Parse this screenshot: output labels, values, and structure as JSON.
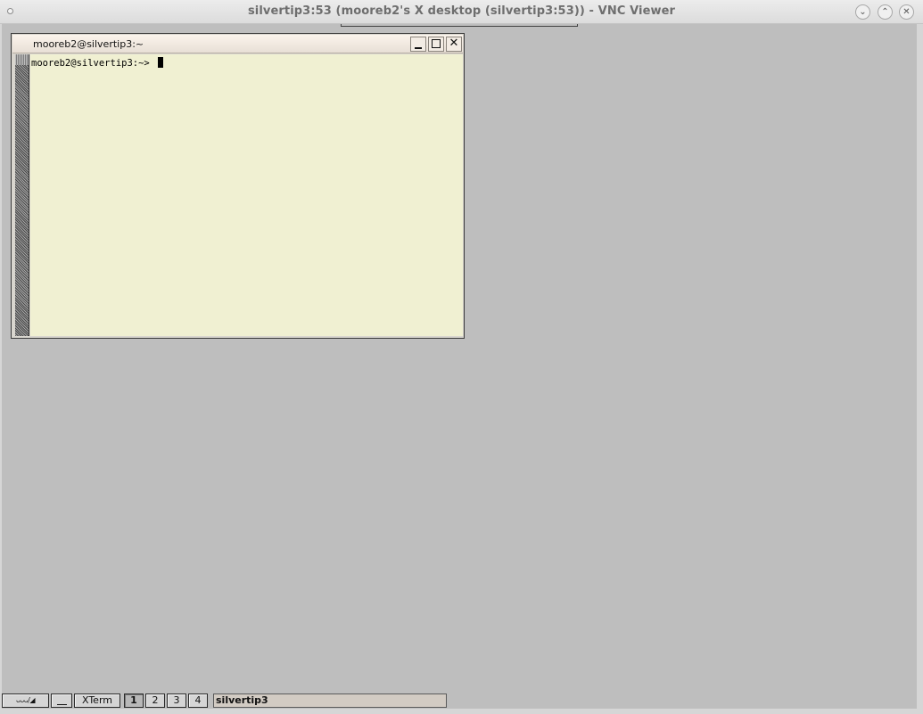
{
  "viewer": {
    "title": "silvertip3:53 (mooreb2's X desktop (silvertip3:53)) - VNC Viewer",
    "buttons": {
      "minimize": "⌄",
      "maximize": "⌃",
      "close": "✕"
    }
  },
  "xterm": {
    "title": "mooreb2@silvertip3:~",
    "close_glyph": "✕",
    "prompt": "mooreb2@silvertip3:~> "
  },
  "taskbar": {
    "icons_label": "ᴗᴗᴗ/◢",
    "xterm_label": "XTerm",
    "desktops": [
      "1",
      "2",
      "3",
      "4"
    ],
    "active_desktop": "1",
    "hostname": "silvertip3"
  },
  "colors": {
    "desktop_bg": "#bebebe",
    "terminal_bg": "#f0f0d2",
    "titlebar_bg": "#f5ede5"
  }
}
